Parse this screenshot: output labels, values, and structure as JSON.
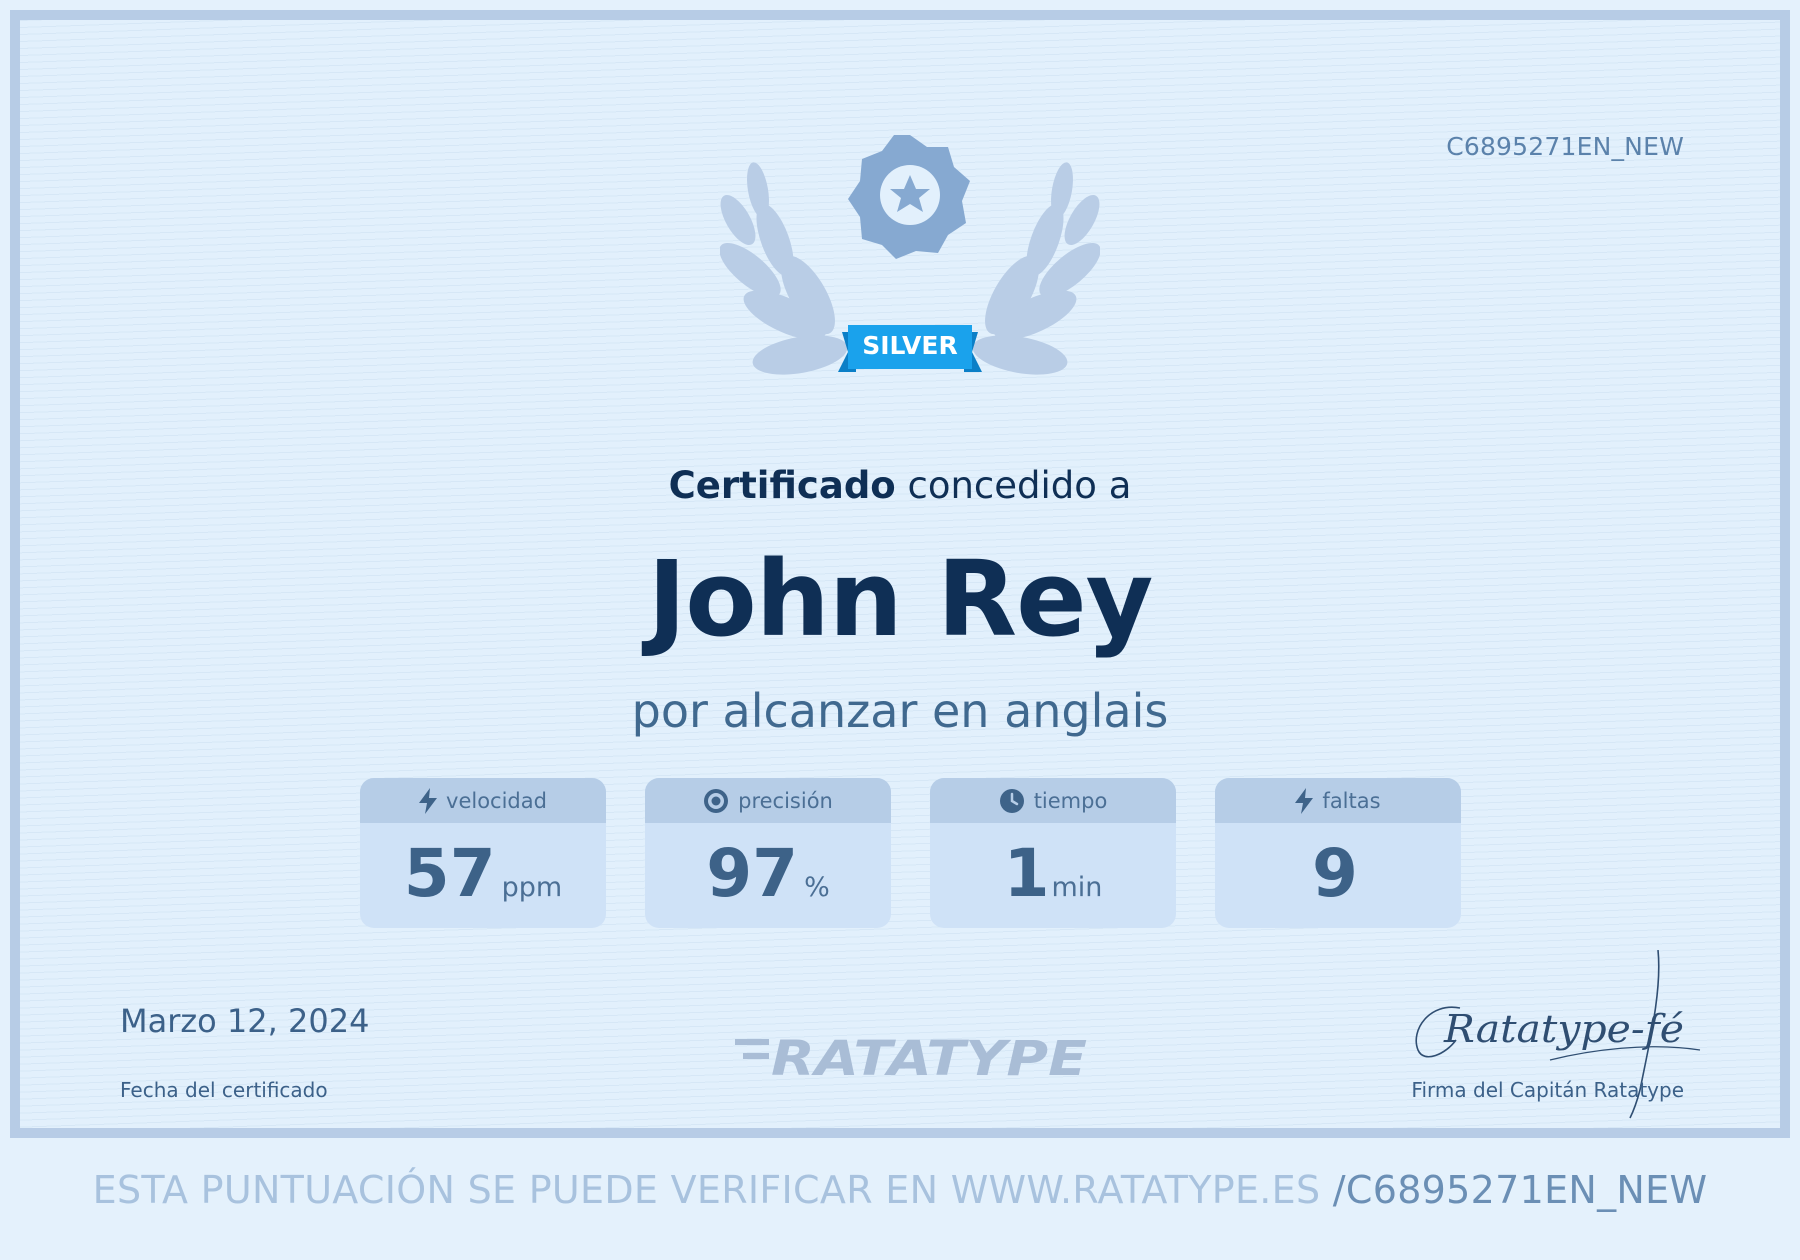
{
  "certificate": {
    "code": "C6895271EN_NEW",
    "badge_label": "SILVER",
    "heading_bold": "Certificado",
    "heading_rest": "concedido a",
    "recipient": "John Rey",
    "subtitle": "por alcanzar en anglais",
    "stats": [
      {
        "label": "velocidad",
        "value": "57",
        "unit": "ppm",
        "icon": "lightning-icon"
      },
      {
        "label": "precisión",
        "value": "97",
        "unit": "%",
        "icon": "target-icon"
      },
      {
        "label": "tiempo",
        "value": "1",
        "unit": "min",
        "icon": "clock-icon"
      },
      {
        "label": "faltas",
        "value": "9",
        "unit": "",
        "icon": "lightning-icon"
      }
    ],
    "date": "Marzo 12, 2024",
    "date_label": "Fecha del certificado",
    "logo_text": "RATATYPE",
    "signature_text": "CRatatype-fé",
    "signature_label": "Firma del Capitán Ratatype"
  },
  "footer": {
    "verify_text": "ESTA PUNTUACIÓN SE PUEDE VERIFICAR EN WWW.RATATYPE.ES",
    "verify_code": "/C6895271EN_NEW"
  },
  "colors": {
    "background": "#e4f1fc",
    "border": "#b7cce6",
    "name": "#0f2f55",
    "badge": "#1aa2ec",
    "emblem": "#8fb0d6"
  }
}
